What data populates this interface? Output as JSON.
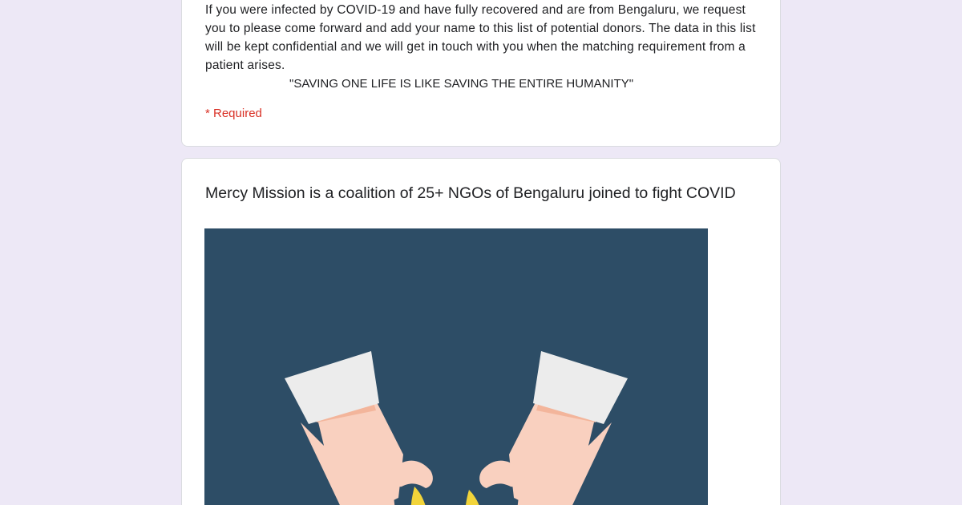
{
  "form": {
    "description": "If you were infected by COVID-19 and have fully recovered and are from Bengaluru, we request you to please come forward and add your name to this list of potential donors. The data in this list will be kept confidential and we will get in touch with you when the matching requirement from a patient arises.",
    "quote": "\"SAVING ONE LIFE IS LIKE SAVING THE ENTIRE HUMANITY\"",
    "required_label": "* Required"
  },
  "section": {
    "title": "Mercy Mission is a coalition of 25+ NGOs of Bengaluru joined to fight COVID",
    "image_icon": "hands-holding-blood-drop-illustration"
  },
  "colors": {
    "background": "#ede8f6",
    "card": "#ffffff",
    "required": "#d93025",
    "illustration_bg": "#2d4d66",
    "cuff": "#ececec",
    "skin": "#f9d0bf",
    "accent": "#f2d43a"
  }
}
